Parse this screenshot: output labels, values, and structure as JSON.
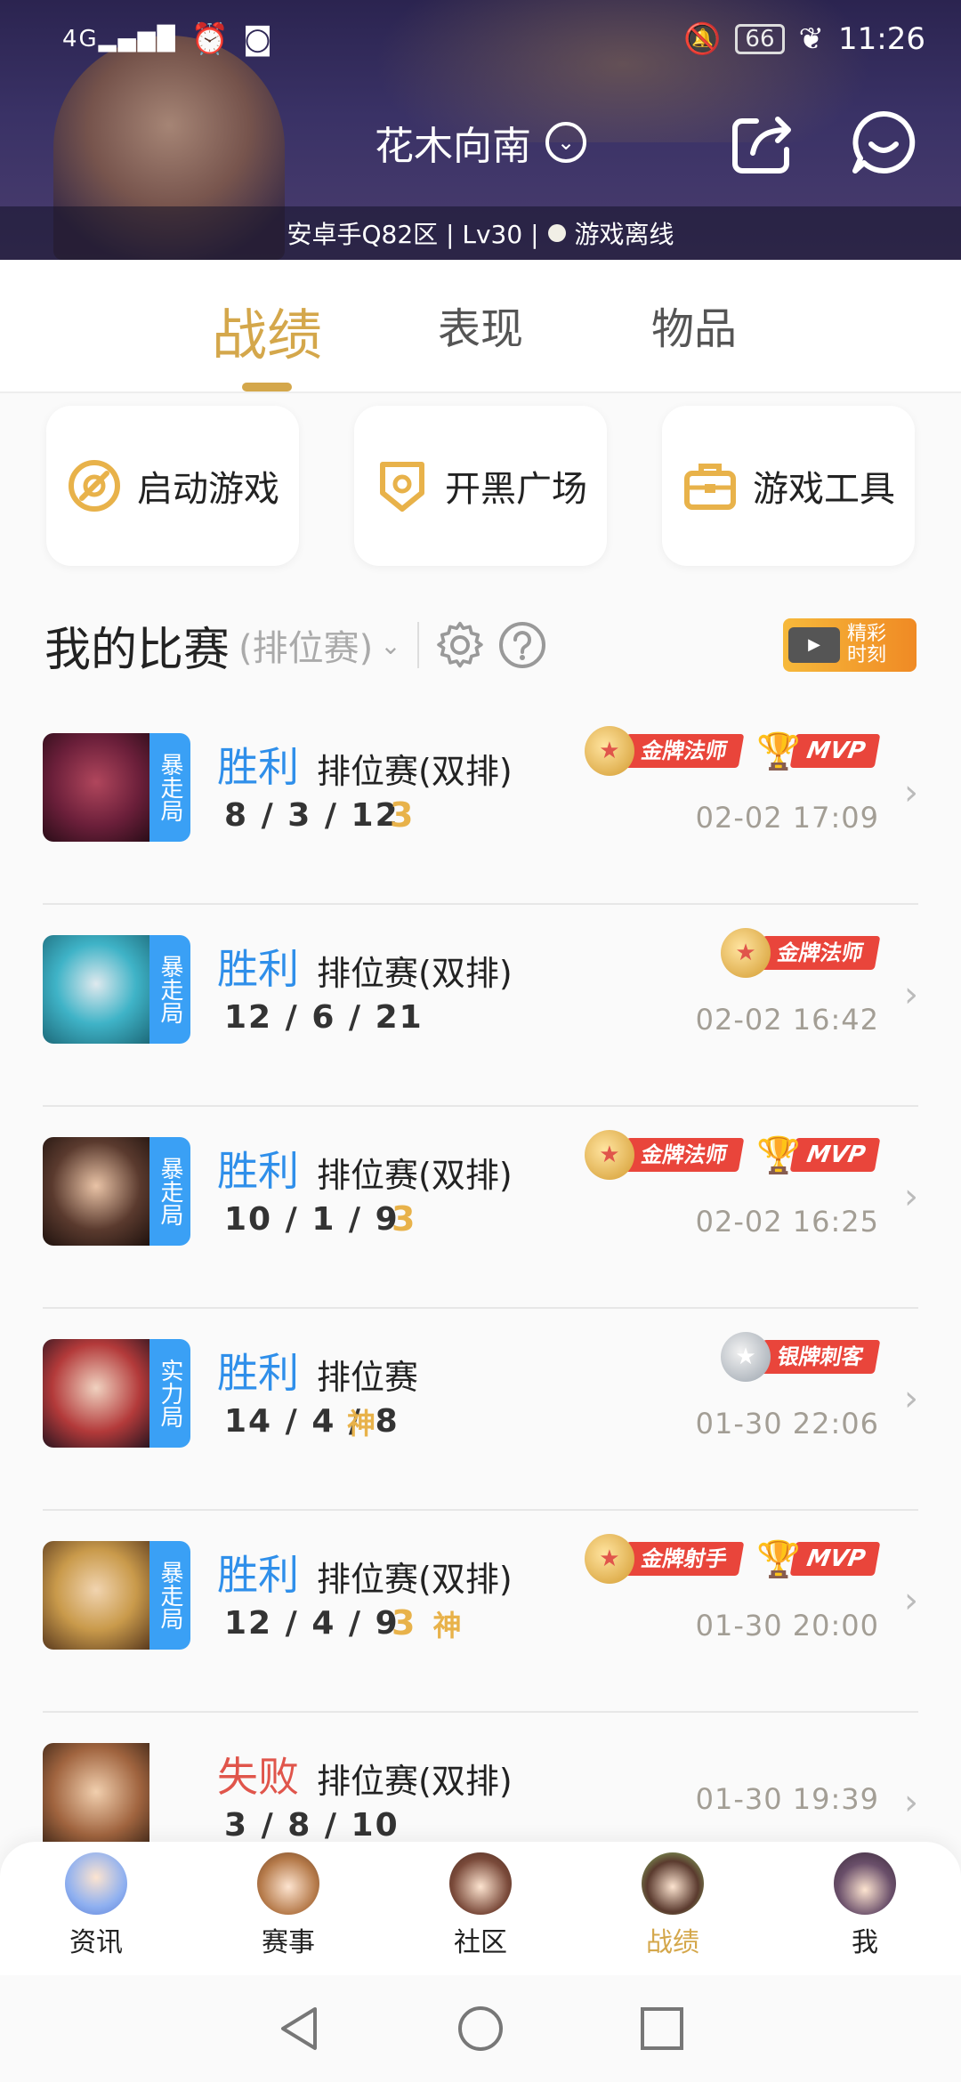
{
  "status_bar": {
    "network": "4G",
    "battery": "66",
    "time": "11:26"
  },
  "profile": {
    "name": "花木向南",
    "info": "安卓手Q82区 | Lv30 |",
    "status": "游戏离线"
  },
  "tabs": [
    "战绩",
    "表现",
    "物品"
  ],
  "quick_actions": [
    "启动游戏",
    "开黑广场",
    "游戏工具"
  ],
  "section": {
    "title": "我的比赛",
    "filter": "(排位赛)",
    "highlight_line1": "精彩",
    "highlight_line2": "时刻"
  },
  "matches": [
    {
      "tag": "暴走局",
      "result": "胜利",
      "mode": "排位赛(双排)",
      "kda": "8 / 3 / 12",
      "icons": [
        "3"
      ],
      "badge": "金牌法师",
      "mvp": "MVP",
      "time": "02-02 17:09",
      "avatar_color": "#6b1f3a"
    },
    {
      "tag": "暴走局",
      "result": "胜利",
      "mode": "排位赛(双排)",
      "kda": "12 / 6 / 21",
      "icons": [],
      "badge": "金牌法师",
      "mvp": "",
      "time": "02-02 16:42",
      "avatar_color": "#3fb3c7"
    },
    {
      "tag": "暴走局",
      "result": "胜利",
      "mode": "排位赛(双排)",
      "kda": "10 / 1 / 9",
      "icons": [
        "3"
      ],
      "badge": "金牌法师",
      "mvp": "MVP",
      "time": "02-02 16:25",
      "avatar_color": "#5a3a2e"
    },
    {
      "tag": "实力局",
      "result": "胜利",
      "mode": "排位赛",
      "kda": "14 / 4 / 8",
      "icons": [
        "神"
      ],
      "badge": "银牌刺客",
      "mvp": "",
      "time": "01-30 22:06",
      "avatar_color": "#b33a3a"
    },
    {
      "tag": "暴走局",
      "result": "胜利",
      "mode": "排位赛(双排)",
      "kda": "12 / 4 / 9",
      "icons": [
        "3",
        "神"
      ],
      "badge": "金牌射手",
      "mvp": "MVP",
      "time": "01-30 20:00",
      "avatar_color": "#c99a4b"
    },
    {
      "tag": "",
      "result": "失败",
      "mode": "排位赛(双排)",
      "kda": "3 / 8 / 10",
      "icons": [],
      "badge": "",
      "mvp": "",
      "time": "01-30 19:39",
      "avatar_color": "#a0643f"
    }
  ],
  "bottom_nav": [
    "资讯",
    "赛事",
    "社区",
    "战绩",
    "我"
  ],
  "colors": {
    "accent_gold": "#d4a74b",
    "win_blue": "#2f8fea",
    "lose_red": "#e0554b",
    "tag_blue": "#3aa0f5"
  }
}
